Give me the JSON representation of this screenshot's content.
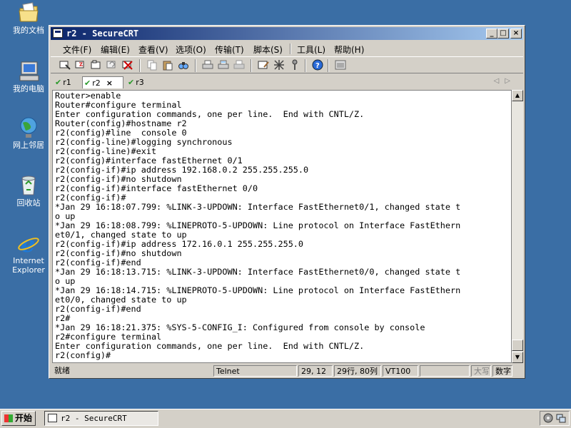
{
  "desktop": {
    "icons": [
      {
        "label": "我的文档",
        "icon": "my-documents-icon"
      },
      {
        "label": "我的电脑",
        "icon": "my-computer-icon"
      },
      {
        "label": "网上邻居",
        "icon": "network-places-icon"
      },
      {
        "label": "回收站",
        "icon": "recycle-bin-icon"
      },
      {
        "label": "Internet Explorer",
        "icon": "internet-explorer-icon"
      }
    ]
  },
  "window": {
    "title": "r2 - SecureCRT",
    "controls": {
      "minimize": "_",
      "maximize": "□",
      "close": "×"
    }
  },
  "menu": [
    "文件(F)",
    "编辑(E)",
    "查看(V)",
    "选项(O)",
    "传输(T)",
    "脚本(S)",
    "工具(L)",
    "帮助(H)"
  ],
  "toolbar": {
    "icons": [
      "connect-icon",
      "quick-connect-icon",
      "connect-tab-icon",
      "reconnect-icon",
      "disconnect-icon",
      "copy-icon",
      "paste-icon",
      "find-icon",
      "print-icon",
      "print-selection-icon",
      "print-setup-icon",
      "session-options-icon",
      "global-options-icon",
      "keymap-icon",
      "help-icon",
      "sftp-icon"
    ]
  },
  "tabs": [
    {
      "label": "r1",
      "active": false
    },
    {
      "label": "r2",
      "active": true,
      "close": "×"
    },
    {
      "label": "r3",
      "active": false
    }
  ],
  "terminal": {
    "lines": [
      "Router>enable",
      "Router#configure terminal",
      "Enter configuration commands, one per line.  End with CNTL/Z.",
      "Router(config)#hostname r2",
      "r2(config)#line  console 0",
      "r2(config-line)#logging synchronous",
      "r2(config-line)#exit",
      "r2(config)#interface fastEthernet 0/1",
      "r2(config-if)#ip address 192.168.0.2 255.255.255.0",
      "r2(config-if)#no shutdown",
      "r2(config-if)#interface fastEthernet 0/0",
      "r2(config-if)#",
      "*Jan 29 16:18:07.799: %LINK-3-UPDOWN: Interface FastEthernet0/1, changed state t",
      "o up",
      "*Jan 29 16:18:08.799: %LINEPROTO-5-UPDOWN: Line protocol on Interface FastEthern",
      "et0/1, changed state to up",
      "r2(config-if)#ip address 172.16.0.1 255.255.255.0",
      "r2(config-if)#no shutdown",
      "r2(config-if)#end",
      "*Jan 29 16:18:13.715: %LINK-3-UPDOWN: Interface FastEthernet0/0, changed state t",
      "o up",
      "*Jan 29 16:18:14.715: %LINEPROTO-5-UPDOWN: Line protocol on Interface FastEthern",
      "et0/0, changed state to up",
      "r2(config-if)#end",
      "r2#",
      "*Jan 29 16:18:21.375: %SYS-5-CONFIG_I: Configured from console by console",
      "r2#configure terminal",
      "Enter configuration commands, one per line.  End with CNTL/Z.",
      "r2(config)#"
    ]
  },
  "status": {
    "ready": "就绪",
    "protocol": "Telnet",
    "cursor": "29, 12",
    "size": "29行, 80列",
    "emulation": "VT100",
    "caps": "大写",
    "num": "数字"
  },
  "taskbar": {
    "start": "开始",
    "task": "r2 - SecureCRT"
  },
  "colors": {
    "desktop": "#3a6ea5",
    "titlebar_start": "#0a246a",
    "titlebar_end": "#a6caf0",
    "tab_check": "#2a9a2a"
  }
}
